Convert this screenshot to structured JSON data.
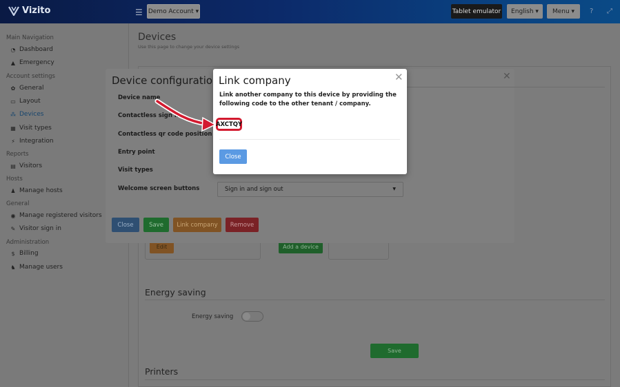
{
  "app": {
    "logo_text": "Vizito"
  },
  "header": {
    "account_button": "Demo Account",
    "tablet_button": "Tablet emulator",
    "language_button": "English",
    "menu_button": "Menu",
    "help_icon": "?",
    "expand_icon": "⤢"
  },
  "sidebar": {
    "sections": {
      "main": "Main Navigation",
      "account": "Account settings",
      "reports": "Reports",
      "hosts": "Hosts",
      "general": "General",
      "administration": "Administration"
    },
    "items": [
      {
        "label": "Dashboard",
        "icon": "dashboard-icon"
      },
      {
        "label": "Emergency",
        "icon": "warning-icon"
      },
      {
        "label": "General",
        "icon": "gear-icon"
      },
      {
        "label": "Layout",
        "icon": "layout-icon"
      },
      {
        "label": "Devices",
        "icon": "devices-icon",
        "active": true
      },
      {
        "label": "Visit types",
        "icon": "list-icon"
      },
      {
        "label": "Integration",
        "icon": "plug-icon"
      },
      {
        "label": "Visitors",
        "icon": "visitors-icon"
      },
      {
        "label": "Manage hosts",
        "icon": "hosts-icon"
      },
      {
        "label": "Manage registered visitors",
        "icon": "registered-icon"
      },
      {
        "label": "Visitor sign in",
        "icon": "pen-icon"
      },
      {
        "label": "Billing",
        "icon": "dollar-icon"
      },
      {
        "label": "Manage users",
        "icon": "users-icon"
      }
    ]
  },
  "page": {
    "title": "Devices",
    "subtitle": "Use this page to change your device settings",
    "sections": {
      "energy_title": "Energy saving",
      "energy_label": "Energy saving",
      "energy_save": "Save",
      "printers_title": "Printers",
      "edit_button": "Edit",
      "add_device_button": "Add a device"
    }
  },
  "device_config": {
    "title": "Device configuration",
    "labels": [
      "Device name",
      "Contactless sign in",
      "Contactless qr code position",
      "Entry point",
      "Visit types",
      "Welcome screen buttons"
    ],
    "welcome_select_value": "Sign in and sign out",
    "buttons": {
      "close": "Close",
      "save": "Save",
      "link": "Link company",
      "remove": "Remove"
    }
  },
  "link_company": {
    "title": "Link company",
    "description": "Link another company to this device by providing the following code to the other tenant / company.",
    "code": "AXCTQY",
    "close_button": "Close"
  },
  "colors": {
    "primary_blue": "#5b9ae3",
    "green": "#27a744",
    "orange": "#e8962a",
    "red": "#d9363e",
    "highlight_red": "#d31a2f"
  }
}
